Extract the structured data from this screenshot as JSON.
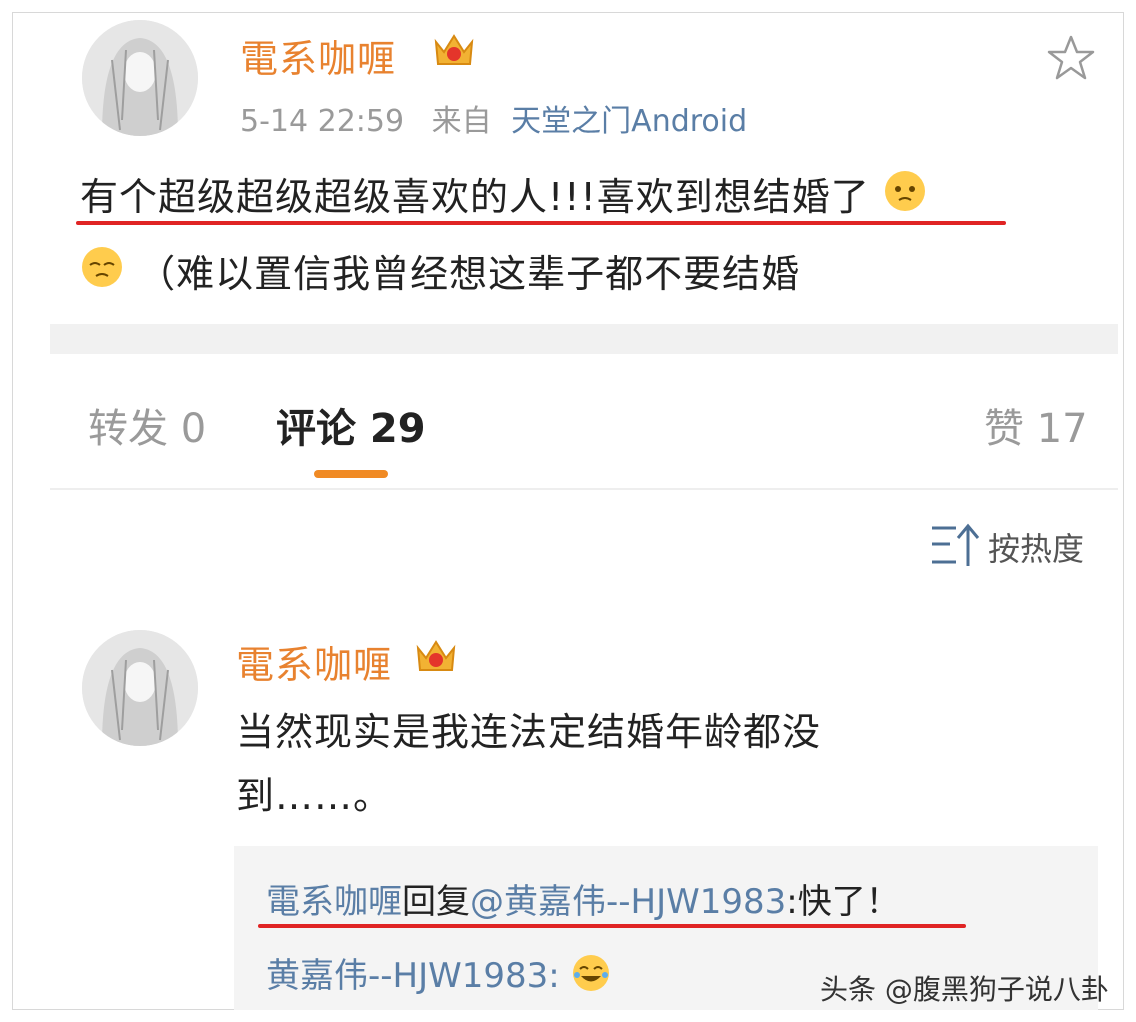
{
  "post": {
    "author": "電系咖喱",
    "time": "5-14 22:59",
    "from_label": "来自",
    "source": "天堂之门Android",
    "text_line1": "有个超级超级超级喜欢的人!!!喜欢到想结婚了",
    "text_line2": "（难以置信我曾经想这辈子都不要结婚"
  },
  "tabs": {
    "repost": "转发 0",
    "comments": "评论 29",
    "likes": "赞 17"
  },
  "sort": {
    "label": "按热度"
  },
  "comment": {
    "author": "電系咖喱",
    "text_line1": "当然现实是我连法定结婚年龄都没",
    "text_line2": "到……。",
    "reply1_user": "電系咖喱",
    "reply1_action": "回复",
    "reply1_mention": "@黄嘉伟--HJW1983",
    "reply1_text": ":快了！",
    "reply2_user": "黄嘉伟--HJW1983",
    "reply2_sep": ":"
  },
  "watermark": "头条 @腹黑狗子说八卦",
  "colors": {
    "author": "#e8822f",
    "link": "#5a7ea6",
    "underline": "#e02424",
    "tab_indicator": "#f08a24"
  }
}
